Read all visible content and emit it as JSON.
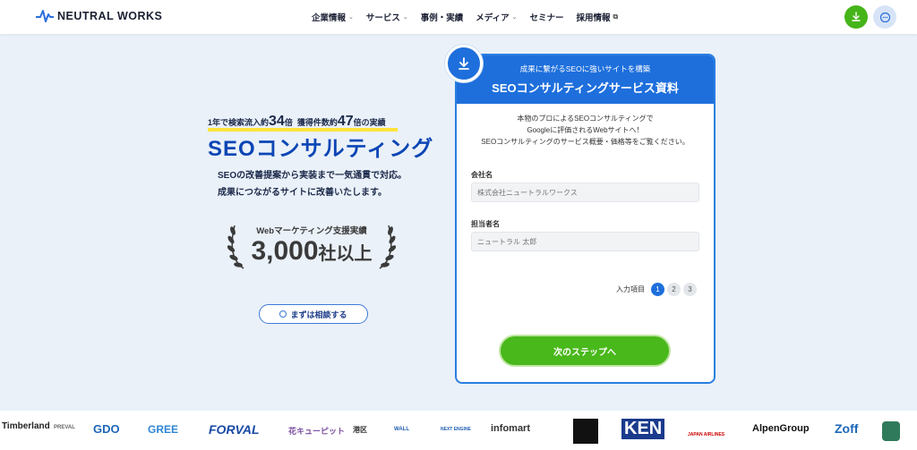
{
  "header": {
    "brand": "NEUTRAL WORKS",
    "nav": [
      {
        "label": "企業情報",
        "chevron": true
      },
      {
        "label": "サービス",
        "chevron": true
      },
      {
        "label": "事例・実績",
        "chevron": false
      },
      {
        "label": "メディア",
        "chevron": true
      },
      {
        "label": "セミナー",
        "chevron": false
      },
      {
        "label": "採用情報",
        "chevron": false
      }
    ],
    "download_icon": "download-icon",
    "chat_icon": "chat-icon"
  },
  "hero": {
    "stat_prefix1": "1年で検索流入約",
    "stat_num1": "34",
    "stat_unit1": "倍",
    "stat_prefix2": "獲得件数約",
    "stat_num2": "47",
    "stat_unit2": "倍の実績",
    "title": "SEOコンサルティング",
    "desc_line1": "SEOの改善提案から実装まで一気通貫で対応。",
    "desc_line2": "成果につながるサイトに改善いたします。",
    "award_sub": "Webマーケティング支援実績",
    "award_num": "3,000",
    "award_unit": "社以上",
    "consult_button": "まずは相談する"
  },
  "form": {
    "subtitle": "成果に繋がるSEOに強いサイトを構築",
    "title": "SEOコンサルティングサービス資料",
    "intro_line1": "本物のプロによるSEOコンサルティングで",
    "intro_line2": "Googleに評価されるWebサイトへ！",
    "intro_line3": "SEOコンサルティングのサービス概要・価格等をご覧ください。",
    "company_label": "会社名",
    "company_placeholder": "株式会社ニュートラルワークス",
    "person_label": "担当者名",
    "person_placeholder": "ニュートラル 太郎",
    "steps_label": "入力項目",
    "steps": [
      "1",
      "2",
      "3"
    ],
    "active_step": 1,
    "next_button": "次のステップへ"
  },
  "client_logos": [
    "Timberland",
    "PREVAL",
    "GDO",
    "GREE",
    "FORVAL",
    "花キューピット",
    "港区",
    "WALL",
    "NEXT ENGINE",
    "infomart",
    "KEN",
    "JAPAN AIRLINES",
    "AlpenGroup",
    "Zoff"
  ],
  "colors": {
    "primary_blue": "#1e6fdc",
    "green": "#49b81b",
    "highlight_yellow": "#ffe33a",
    "background": "#eaf1f9"
  }
}
